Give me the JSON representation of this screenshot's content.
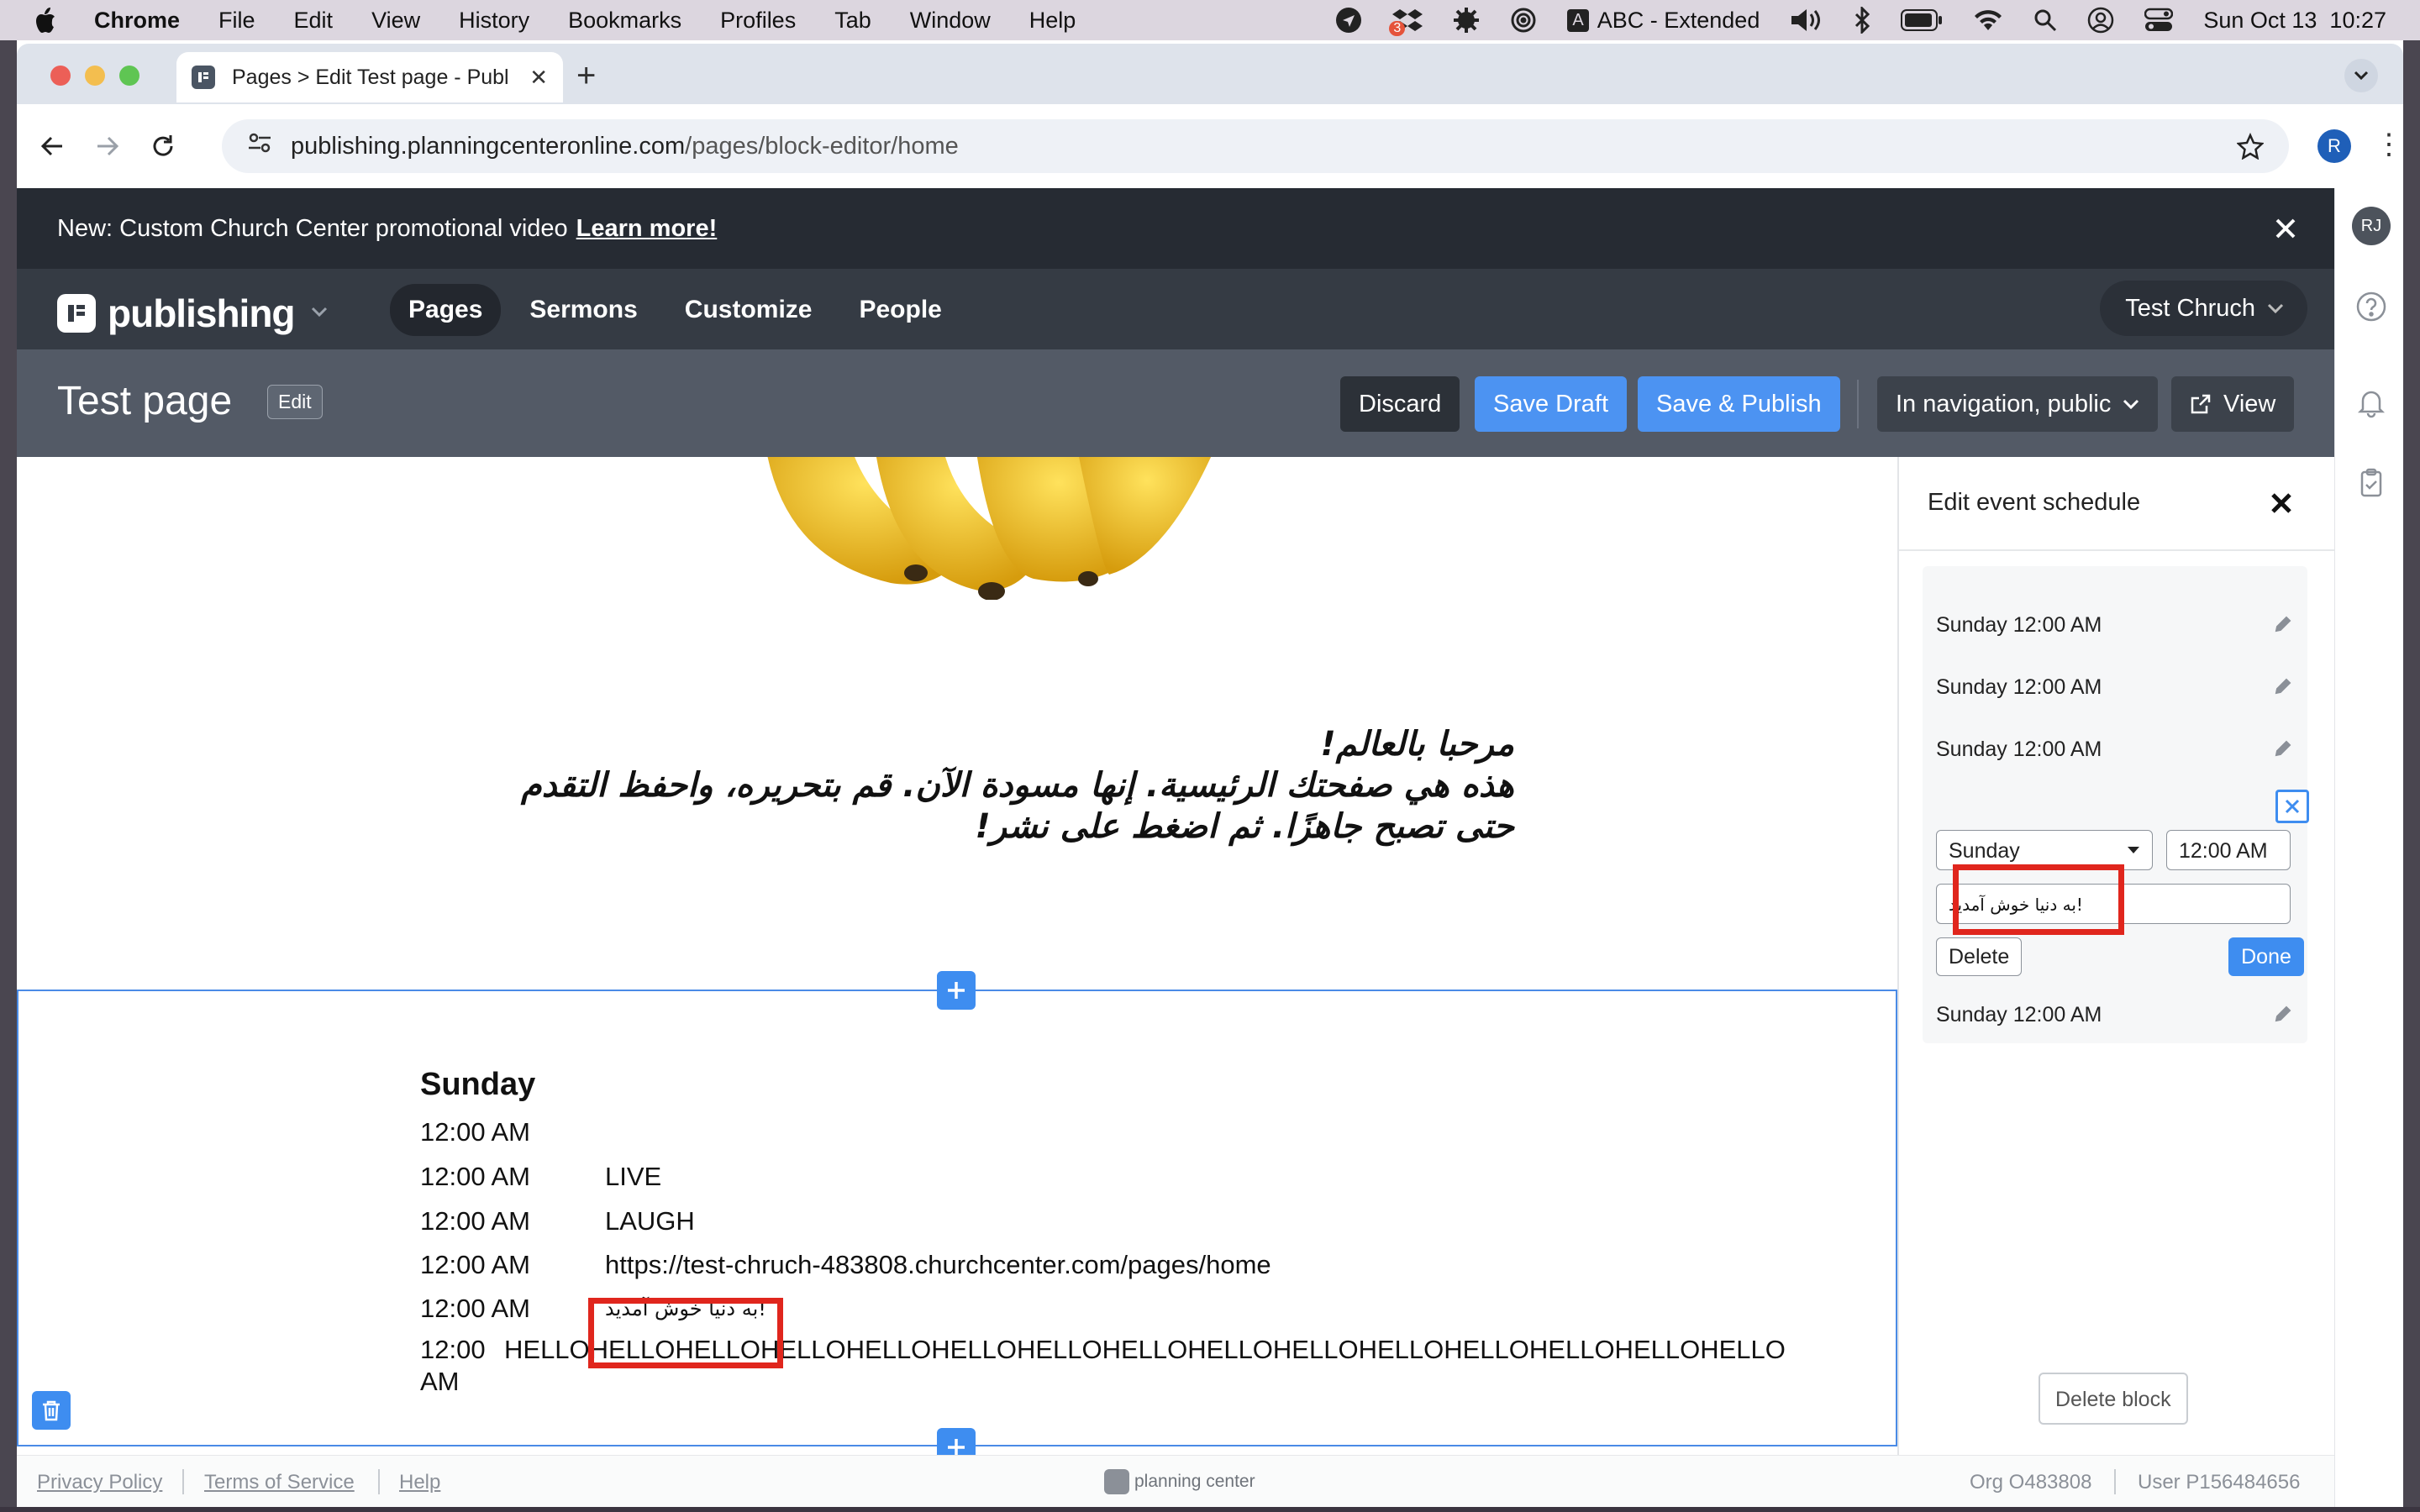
{
  "os_menubar": {
    "app": "Chrome",
    "items": [
      "File",
      "Edit",
      "View",
      "History",
      "Bookmarks",
      "Profiles",
      "Tab",
      "Window",
      "Help"
    ],
    "badge_count": "3",
    "input_source": "ABC - Extended",
    "datetime": "Sun Oct 13  10:27"
  },
  "browser": {
    "tab_title": "Pages > Edit Test page - Publ",
    "url_host": "publishing.planningcenteronline.com",
    "url_path": "/pages/block-editor/home",
    "profile_initial": "R"
  },
  "banner": {
    "text": "New: Custom Church Center promotional video",
    "link": "Learn more!"
  },
  "app_nav": {
    "logo_text": "publishing",
    "items": [
      "Pages",
      "Sermons",
      "Customize",
      "People"
    ],
    "church": "Test Chruch"
  },
  "page_bar": {
    "title": "Test page",
    "edit": "Edit",
    "discard": "Discard",
    "save_draft": "Save Draft",
    "save_publish": "Save & Publish",
    "visibility": "In navigation, public",
    "view": "View"
  },
  "content": {
    "arabic_line1": "مرحبا بالعالم!",
    "arabic_line2": "هذه هي صفحتك الرئيسية. إنها مسودة الآن. قم بتحريره، واحفظ التقدم حتى تصبح جاهزًا. ثم اضغط على نشر!"
  },
  "schedule": {
    "day": "Sunday",
    "rows": [
      {
        "time": "12:00 AM",
        "desc": ""
      },
      {
        "time": "12:00 AM",
        "desc": "LIVE"
      },
      {
        "time": "12:00 AM",
        "desc": "LAUGH"
      },
      {
        "time": "12:00 AM",
        "desc": "https://test-chruch-483808.churchcenter.com/pages/home"
      },
      {
        "time": "12:00 AM",
        "desc": "!به دنیا خوش آمدید"
      }
    ],
    "long_time": "12:00 AM",
    "long_desc": "HELLOHELLOHELLOHELLOHELLOHELLOHELLOHELLOHELLOHELLOHELLOHELLOHELLOHELLOHELLO"
  },
  "side_panel": {
    "title": "Edit event schedule",
    "items": [
      "Sunday 12:00 AM",
      "Sunday 12:00 AM",
      "Sunday 12:00 AM"
    ],
    "last_item": "Sunday 12:00 AM",
    "day_select": "Sunday",
    "time_value": "12:00 AM",
    "desc_value": "!به دنیا خوش آمدید",
    "delete": "Delete",
    "done": "Done",
    "delete_block": "Delete block"
  },
  "footer": {
    "privacy": "Privacy Policy",
    "terms": "Terms of Service",
    "help": "Help",
    "brand": "planning center",
    "org": "Org O483808",
    "user": "User P156484656"
  },
  "rail": {
    "avatar": "RJ"
  },
  "colors": {
    "accent": "#3e8df0",
    "highlight": "#e0261d",
    "dark_header": "#262b33"
  }
}
